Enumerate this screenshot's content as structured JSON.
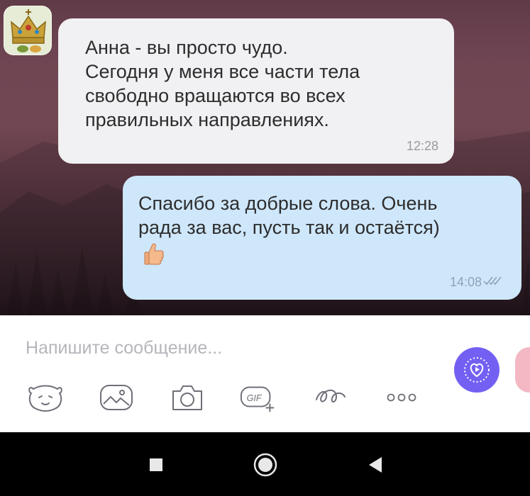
{
  "messages": [
    {
      "direction": "incoming",
      "lines": [
        "Анна - вы просто чудо.",
        "Сегодня у меня все части тела",
        "свободно вращаются во всех",
        "правильных направлениях."
      ],
      "time": "12:28",
      "avatar_icon": "crown-avatar-icon"
    },
    {
      "direction": "outgoing",
      "lines": [
        "Спасибо за добрые слова. Очень",
        "рада за вас, пусть так и остаётся)"
      ],
      "emoji": "thumbs-up-icon",
      "time": "14:08",
      "status_icon": "double-check-icon"
    }
  ],
  "composer": {
    "placeholder": "Напишите сообщение...",
    "tools": [
      "sticker-icon",
      "gallery-icon",
      "camera-icon",
      "gif-icon",
      "doodle-icon",
      "more-icon"
    ],
    "send_icon": "video-message-icon"
  },
  "navbar": {
    "buttons": [
      "recents-icon",
      "home-icon",
      "back-icon"
    ]
  },
  "colors": {
    "accent": "#7360f2",
    "incoming_bubble": "#f1f0f2",
    "outgoing_bubble": "#cfe7fb"
  }
}
